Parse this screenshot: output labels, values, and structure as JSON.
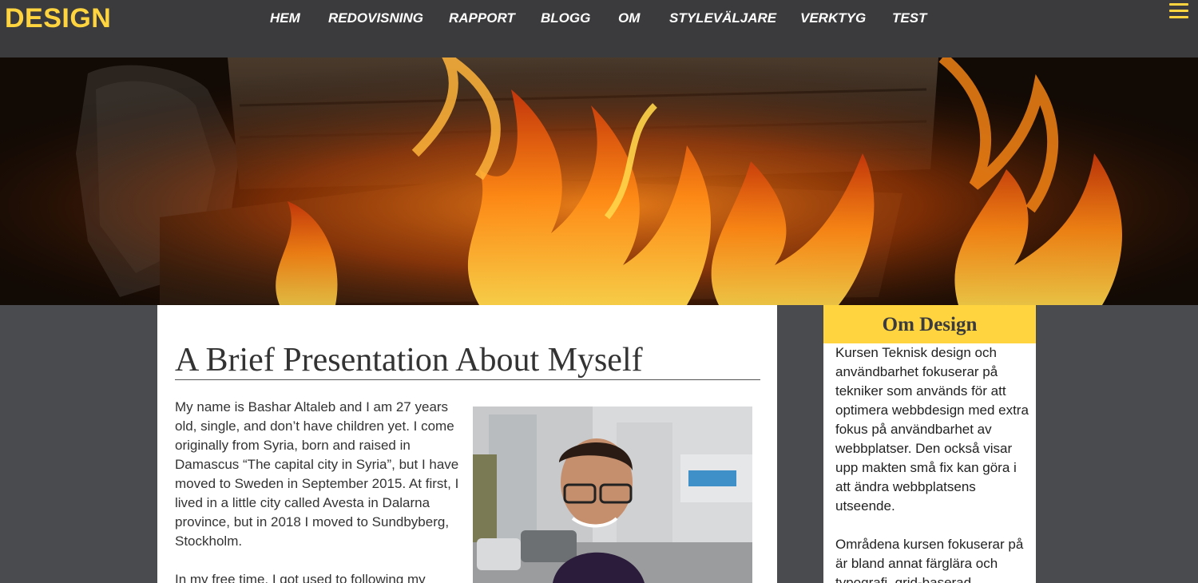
{
  "site": {
    "logo": "DESIGN"
  },
  "nav": {
    "items": [
      {
        "label": "HEM"
      },
      {
        "label": "REDOVISNING"
      },
      {
        "label": "RAPPORT"
      },
      {
        "label": "BLOGG"
      },
      {
        "label": "OM"
      },
      {
        "label": "STYLEVÄLJARE"
      },
      {
        "label": "VERKTYG"
      },
      {
        "label": "TEST"
      }
    ],
    "menu_icon": "hamburger-icon"
  },
  "hero": {
    "image": "burning-firewood-photo"
  },
  "main": {
    "title": "A Brief Presentation About Myself",
    "paragraphs": [
      "My name is Bashar Altaleb and I am 27 years old, single, and don’t have children yet. I come originally from Syria, born and raised in Damascus “The capital city in Syria”, but I have moved to Sweden in September 2015. At first, I lived in a little city called Avesta in Dalarna province, but in 2018 I moved to Sundbyberg, Stockholm.",
      "In my free time, I got used to following my"
    ],
    "photo": "portrait-photo"
  },
  "aside": {
    "title": "Om Design",
    "paragraphs": [
      "Kursen Teknisk design och användbarhet fokuserar på tekniker som används för att optimera webbdesign med extra fokus på användbarhet av webbplatser. Den också visar upp makten små fix kan göra i att ändra webbplatsens utseende.",
      "Områdena kursen fokuserar på är bland annat färglära och typografi, grid-baserad"
    ]
  },
  "colors": {
    "accent": "#ffd43f",
    "topbar": "#3b3b3d",
    "page_bg": "#4a4b4e",
    "content_bg": "#ffffff"
  }
}
